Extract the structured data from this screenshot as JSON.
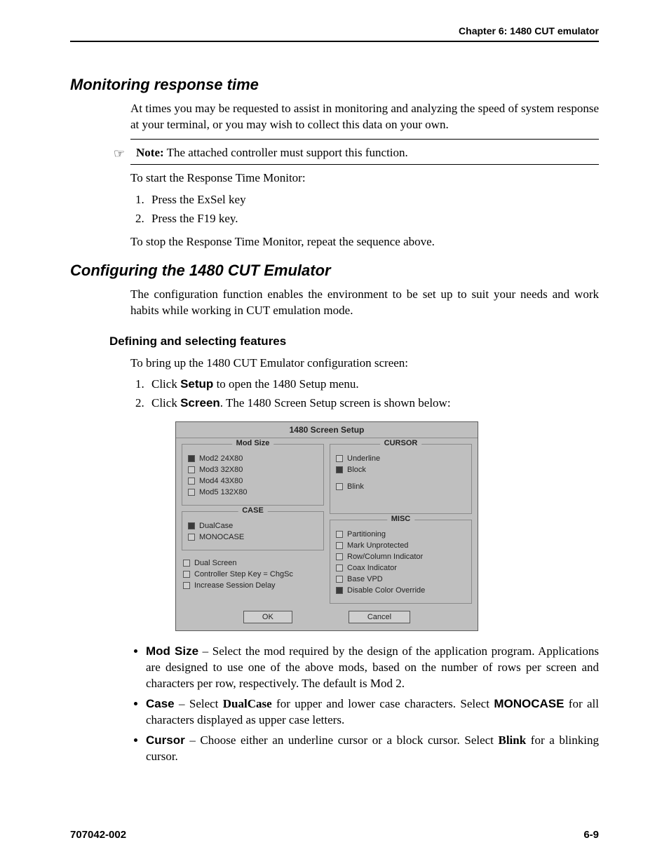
{
  "header": {
    "chapter": "Chapter 6: 1480 CUT emulator"
  },
  "section1": {
    "title": "Monitoring response time",
    "intro": "At times you may be requested to assist in monitoring and analyzing the speed of system response at your terminal, or you may wish to collect this data on your own.",
    "note_icon": "☞",
    "note_label": "Note:",
    "note_text": " The attached controller must support this function.",
    "lead": "To start the Response Time Monitor:",
    "steps": [
      "Press the ExSel key",
      "Press the F19 key."
    ],
    "tail": "To stop the Response Time Monitor, repeat the sequence above."
  },
  "section2": {
    "title": "Configuring the 1480 CUT Emulator",
    "intro": "The configuration function enables the environment to be set up to suit your needs and work habits while working in CUT emulation mode.",
    "sub_title": "Defining and selecting features",
    "lead": "To bring up the 1480 CUT Emulator configuration screen:",
    "step1_pre": "Click ",
    "step1_bold": "Setup",
    "step1_post": " to open the 1480 Setup menu.",
    "step2_pre": "Click ",
    "step2_bold": "Screen",
    "step2_post": ". The 1480 Screen Setup screen is shown below:"
  },
  "dialog": {
    "title": "1480 Screen Setup",
    "mod_size": {
      "legend": "Mod Size",
      "options": [
        {
          "label": "Mod2 24X80",
          "checked": true
        },
        {
          "label": "Mod3 32X80",
          "checked": false
        },
        {
          "label": "Mod4 43X80",
          "checked": false
        },
        {
          "label": "Mod5 132X80",
          "checked": false
        }
      ]
    },
    "case_group": {
      "legend": "CASE",
      "options": [
        {
          "label": "DualCase",
          "checked": true
        },
        {
          "label": "MONOCASE",
          "checked": false
        }
      ]
    },
    "extra": {
      "options": [
        {
          "label": "Dual Screen",
          "checked": false
        },
        {
          "label": "Controller Step Key = ChgSc",
          "checked": false
        },
        {
          "label": "Increase Session Delay",
          "checked": false
        }
      ]
    },
    "cursor": {
      "legend": "CURSOR",
      "options": [
        {
          "label": "Underline",
          "checked": false
        },
        {
          "label": "Block",
          "checked": true
        },
        {
          "label": "Blink",
          "checked": false
        }
      ]
    },
    "misc": {
      "legend": "MISC",
      "options": [
        {
          "label": "Partitioning",
          "checked": false
        },
        {
          "label": "Mark Unprotected",
          "checked": false
        },
        {
          "label": "Row/Column Indicator",
          "checked": false
        },
        {
          "label": "Coax Indicator",
          "checked": false
        },
        {
          "label": "Base VPD",
          "checked": false
        },
        {
          "label": "Disable Color Override",
          "checked": true
        }
      ]
    },
    "buttons": {
      "ok": "OK",
      "cancel": "Cancel"
    }
  },
  "bullets": {
    "b1_label": "Mod Size",
    "b1_text": " – Select the mod required by the design of the application program. Applications are designed to use one of the above mods, based on the number of rows per screen and characters per row, respectively. The default is Mod 2.",
    "b2_label": "Case",
    "b2_mid1": " – Select ",
    "b2_bold1": "DualCase",
    "b2_mid2": " for upper and lower case characters. Select ",
    "b2_bold2": "MONOCASE",
    "b2_tail": " for all characters displayed as upper case letters.",
    "b3_label": "Cursor",
    "b3_mid1": " – Choose either an underline cursor or a block cursor. Select ",
    "b3_bold1": "Blink",
    "b3_tail": " for a blinking cursor."
  },
  "footer": {
    "left": "707042-002",
    "right": "6-9"
  }
}
